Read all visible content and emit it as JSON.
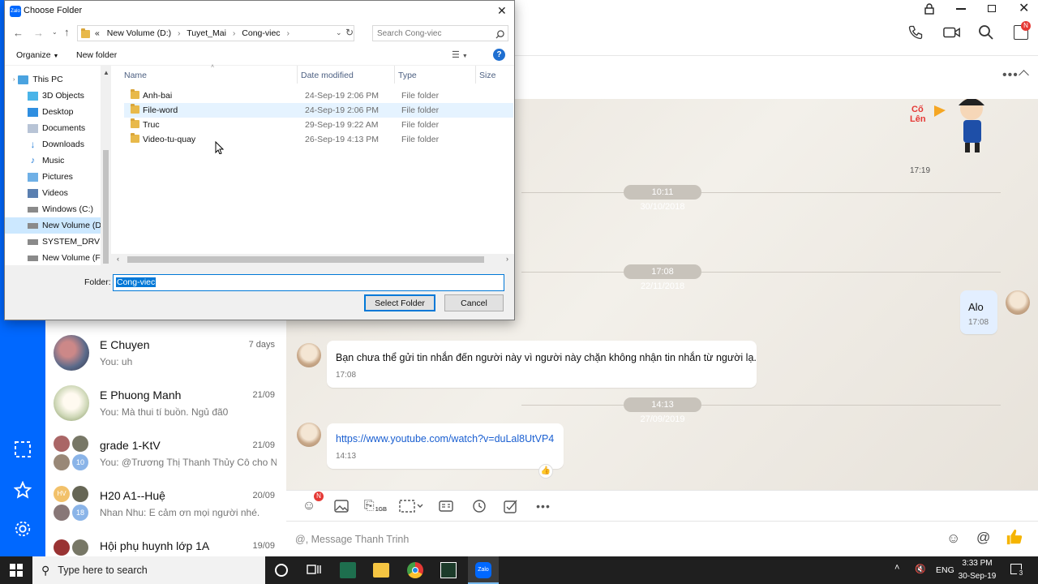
{
  "dialog": {
    "title": "Choose Folder",
    "breadcrumb": [
      "«",
      "New Volume (D:)",
      "Tuyet_Mai",
      "Cong-viec"
    ],
    "search_placeholder": "Search Cong-viec",
    "organize_label": "Organize",
    "new_folder_label": "New folder",
    "nav_items": [
      {
        "label": "This PC",
        "icon": "pc-icon"
      },
      {
        "label": "3D Objects",
        "icon": "cube-icon"
      },
      {
        "label": "Desktop",
        "icon": "desktop-icon"
      },
      {
        "label": "Documents",
        "icon": "documents-icon"
      },
      {
        "label": "Downloads",
        "icon": "download-icon"
      },
      {
        "label": "Music",
        "icon": "music-icon"
      },
      {
        "label": "Pictures",
        "icon": "pictures-icon"
      },
      {
        "label": "Videos",
        "icon": "videos-icon"
      },
      {
        "label": "Windows (C:)",
        "icon": "drive-icon"
      },
      {
        "label": "New Volume (D:)",
        "icon": "drive-icon"
      },
      {
        "label": "SYSTEM_DRV (E:)",
        "icon": "drive-icon"
      },
      {
        "label": "New Volume (F:)",
        "icon": "drive-icon"
      }
    ],
    "columns": {
      "name": "Name",
      "date": "Date modified",
      "type": "Type",
      "size": "Size"
    },
    "files": [
      {
        "name": "Anh-bai",
        "date": "24-Sep-19 2:06 PM",
        "type": "File folder"
      },
      {
        "name": "File-word",
        "date": "24-Sep-19 2:06 PM",
        "type": "File folder"
      },
      {
        "name": "Truc",
        "date": "29-Sep-19 9:22 AM",
        "type": "File folder"
      },
      {
        "name": "Video-tu-quay",
        "date": "26-Sep-19 4:13 PM",
        "type": "File folder"
      }
    ],
    "folder_label": "Folder:",
    "folder_value": "Cong-viec",
    "select_button": "Select Folder",
    "cancel_button": "Cancel"
  },
  "conversations": [
    {
      "name": "E Chuyen",
      "preview": "You: uh",
      "time": "7 days"
    },
    {
      "name": "E Phuong Manh",
      "preview": "You: Mà thui tí buồn. Ngủ đã0",
      "time": "21/09"
    },
    {
      "name": "grade 1-KtV",
      "preview": "You: @Trương Thị Thanh Thủy Cô cho N...",
      "time": "21/09",
      "badge": "10"
    },
    {
      "name": "H20 A1--Huệ",
      "preview": "Nhan Nhu: E cảm ơn mọi người nhé.",
      "time": "20/09",
      "badge": "18",
      "initials": "HV"
    },
    {
      "name": "Hội phụ huynh lớp 1A",
      "preview": "",
      "time": "19/09"
    }
  ],
  "chat": {
    "sticker_time": "17:19",
    "stamps": [
      "10:11 30/10/2018",
      "17:08 22/11/2018",
      "14:13 27/09/2019"
    ],
    "my_message": {
      "text": "Alo",
      "time": "17:08"
    },
    "blocked_message": {
      "text": "Bạn chưa thể gửi tin nhắn đến người này vì người này chặn không nhận tin nhắn từ người lạ.",
      "time": "17:08"
    },
    "link_message": {
      "text": "https://www.youtube.com/watch?v=duLal8UtVP4",
      "time": "14:13"
    },
    "input_placeholder": "@, Message Thanh Trinh",
    "toolbar_badge": "N",
    "file_limit": "1GB",
    "header_badge": "N"
  },
  "taskbar": {
    "search_placeholder": "Type here to search",
    "language": "ENG",
    "time": "3:33 PM",
    "date": "30-Sep-19",
    "notification_count": "3"
  },
  "colors": {
    "zalo_blue": "#0068ff",
    "link": "#1a5fd1",
    "selection": "#0078d7"
  }
}
